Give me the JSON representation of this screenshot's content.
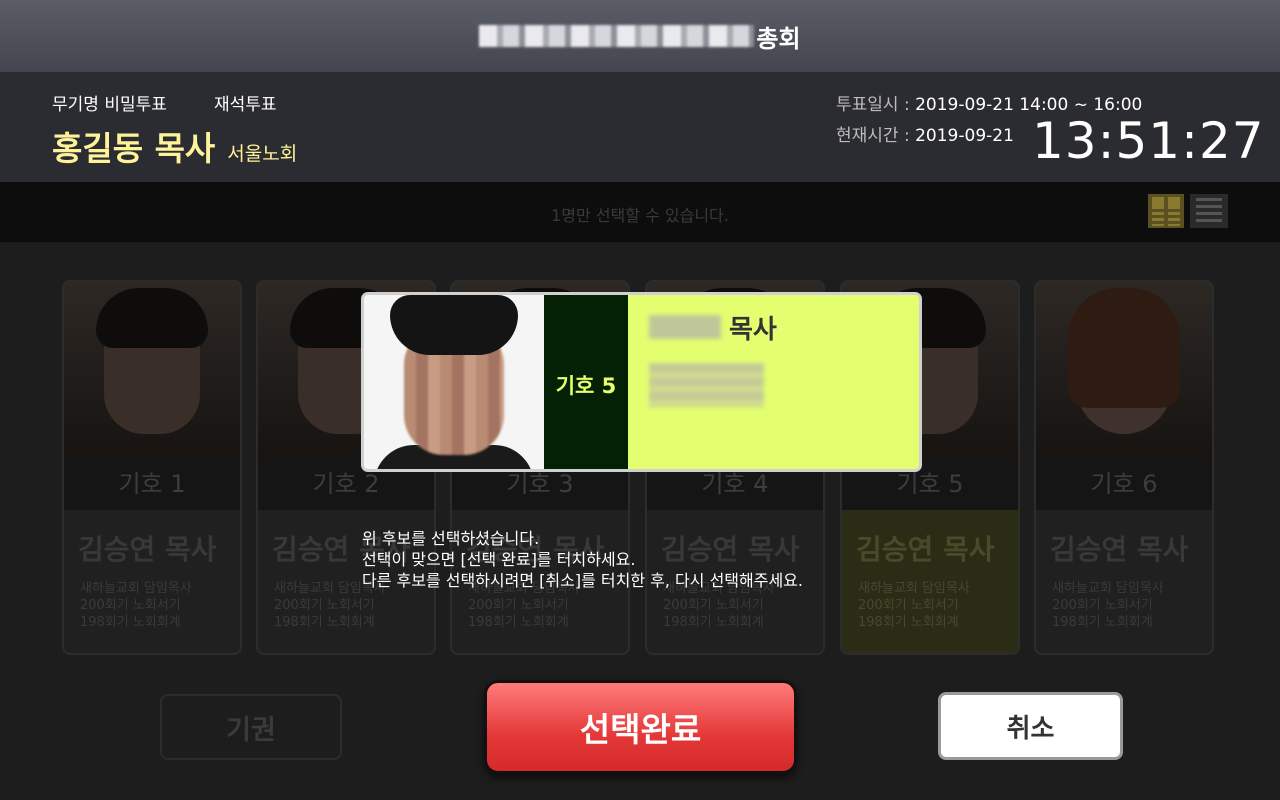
{
  "app": {
    "title_visible_suffix": "총회"
  },
  "header": {
    "vote_type_1": "무기명 비밀투표",
    "vote_type_2": "재석투표",
    "pastor_name": "홍길동 목사",
    "presbytery": "서울노회",
    "vote_period_label": "투표일시 : ",
    "vote_period_value": "2019-09-21 14:00 ~ 16:00",
    "current_time_label": "현재시간 : ",
    "current_date_value": "2019-09-21",
    "clock": "13:51:27"
  },
  "instruction": "1명만 선택할 수 있습니다.",
  "candidates": [
    {
      "number": "기호 1",
      "name": "김승연 목사",
      "desc": [
        "새하늘교회 담임목사",
        "200회기 노회서기",
        "198회기 노회회계"
      ]
    },
    {
      "number": "기호 2",
      "name": "김승연 목사",
      "desc": [
        "새하늘교회 담임목사",
        "200회기 노회서기",
        "198회기 노회회계"
      ]
    },
    {
      "number": "기호 3",
      "name": "김승연 목사",
      "desc": [
        "새하늘교회 담임목사",
        "200회기 노회서기",
        "198회기 노회회계"
      ]
    },
    {
      "number": "기호 4",
      "name": "김승연 목사",
      "desc": [
        "새하늘교회 담임목사",
        "200회기 노회서기",
        "198회기 노회회계"
      ]
    },
    {
      "number": "기호 5",
      "name": "김승연 목사",
      "desc": [
        "새하늘교회 담임목사",
        "200회기 노회서기",
        "198회기 노회회계"
      ]
    },
    {
      "number": "기호 6",
      "name": "김승연 목사",
      "desc": [
        "새하늘교회 담임목사",
        "200회기 노회서기",
        "198회기 노회회계"
      ]
    }
  ],
  "popup": {
    "number": "기호 5",
    "title_suffix": "목사"
  },
  "confirm_message": [
    "위 후보를 선택하셨습니다.",
    "선택이 맞으면 [선택 완료]를 터치하세요.",
    "다른 후보를 선택하시려면 [취소]를 터치한 후, 다시 선택해주세요."
  ],
  "buttons": {
    "abstain": "기권",
    "confirm": "선택완료",
    "cancel": "취소"
  },
  "colors": {
    "accent_yellow": "#fff39a",
    "popup_bg": "#e3ff70",
    "popup_number_bg": "#052105",
    "confirm_red": "#e43838"
  }
}
